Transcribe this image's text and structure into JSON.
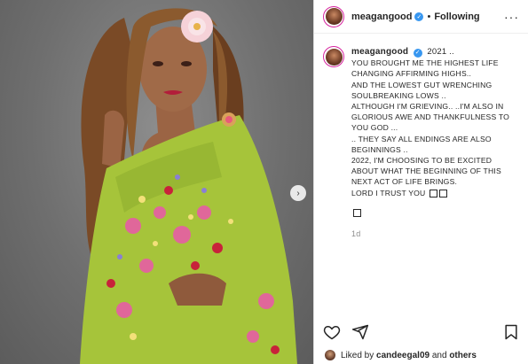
{
  "post": {
    "username": "meagangood",
    "follow_status": "Following",
    "more_icon": "more-icon",
    "caption": {
      "username": "meagangood",
      "year": "2021 ..",
      "lines": [
        "YOU BROUGHT ME THE HIGHEST LIFE",
        "CHANGING AFFIRMING HIGHS..",
        "AND THE LOWEST GUT WRENCHING",
        "SOULBREAKING LOWS ..",
        "ALTHOUGH I'M GRIEVING.. ..I'M ALSO IN",
        "GLORIOUS AWE AND THANKFULNESS TO",
        "YOU GOD ...",
        ".. THEY SAY ALL ENDINGS ARE ALSO",
        "BEGINNINGS ..",
        "2022, I'M CHOOSING TO BE EXCITED",
        "ABOUT WHAT THE BEGINNING OF THIS",
        "NEXT ACT OF LIFE BRINGS.",
        "LORD I TRUST YOU"
      ]
    },
    "time_ago": "1d",
    "likes": {
      "prefix": "Liked by",
      "user": "candeegal09",
      "connector": "and",
      "others": "others"
    }
  },
  "colors": {
    "verified": "#3897f0",
    "dress": "#a6c43a",
    "avatar_ring": "#d6249f"
  }
}
